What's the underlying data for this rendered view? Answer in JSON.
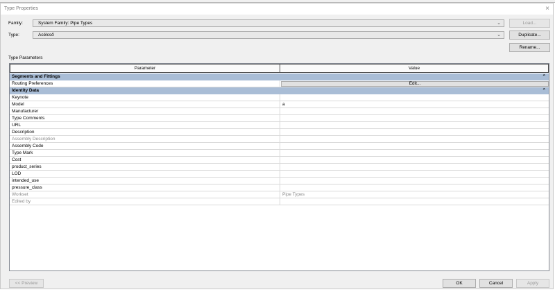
{
  "window": {
    "title": "Type Properties",
    "close_symbol": "×"
  },
  "family": {
    "label": "Family:",
    "value": "System Family: Pipe Types"
  },
  "type": {
    "label": "Type:",
    "value": "Acélcső"
  },
  "buttons": {
    "load": "Load...",
    "duplicate": "Duplicate...",
    "rename": "Rename...",
    "preview": "<< Preview",
    "ok": "OK",
    "cancel": "Cancel",
    "apply": "Apply"
  },
  "section_title": "Type Parameters",
  "table": {
    "headers": {
      "parameter": "Parameter",
      "value": "Value"
    },
    "groups": [
      {
        "title": "Segments and Fittings",
        "collapse_symbol": "⌃",
        "rows": [
          {
            "parameter": "Routing Preferences",
            "value": "Edit...",
            "is_button": true
          }
        ]
      },
      {
        "title": "Identity Data",
        "collapse_symbol": "⌃",
        "rows": [
          {
            "parameter": "Keynote",
            "value": ""
          },
          {
            "parameter": "Model",
            "value": "a"
          },
          {
            "parameter": "Manufacturer",
            "value": ""
          },
          {
            "parameter": "Type Comments",
            "value": ""
          },
          {
            "parameter": "URL",
            "value": ""
          },
          {
            "parameter": "Description",
            "value": ""
          },
          {
            "parameter": "Assembly Description",
            "value": "",
            "grey": true
          },
          {
            "parameter": "Assembly Code",
            "value": ""
          },
          {
            "parameter": "Type Mark",
            "value": ""
          },
          {
            "parameter": "Cost",
            "value": ""
          },
          {
            "parameter": "product_series",
            "value": ""
          },
          {
            "parameter": "LOD",
            "value": ""
          },
          {
            "parameter": "intended_use",
            "value": ""
          },
          {
            "parameter": "pressure_class",
            "value": ""
          },
          {
            "parameter": "Workset",
            "value": "Pipe Types",
            "grey": true
          },
          {
            "parameter": "Edited by",
            "value": "",
            "grey": true
          }
        ]
      }
    ]
  }
}
